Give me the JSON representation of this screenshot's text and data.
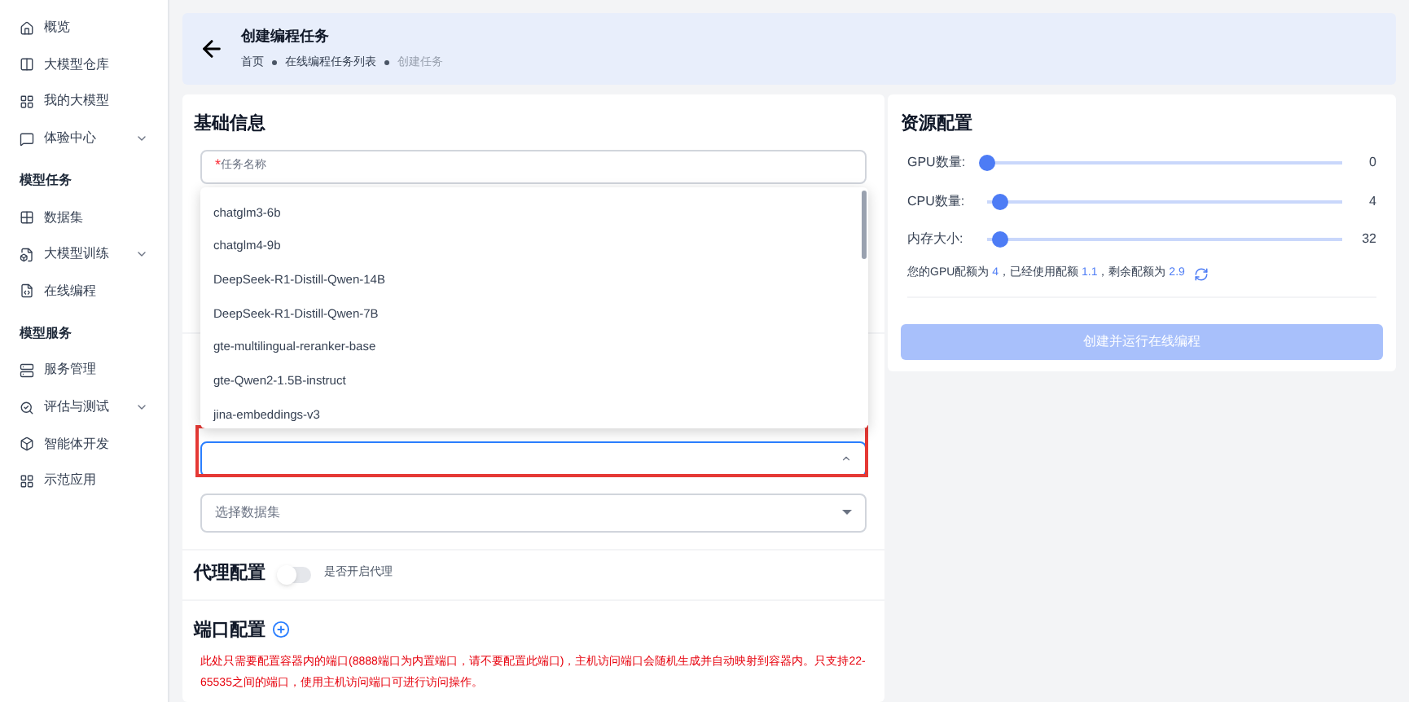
{
  "sidebar": {
    "groups": [
      {
        "items": [
          {
            "label": "概览",
            "expandable": false
          },
          {
            "label": "大模型仓库",
            "expandable": false
          },
          {
            "label": "我的大模型",
            "expandable": false
          },
          {
            "label": "体验中心",
            "expandable": true
          }
        ]
      },
      {
        "heading": "模型任务",
        "items": [
          {
            "label": "数据集",
            "expandable": false
          },
          {
            "label": "大模型训练",
            "expandable": true
          },
          {
            "label": "在线编程",
            "expandable": false
          }
        ]
      },
      {
        "heading": "模型服务",
        "items": [
          {
            "label": "服务管理",
            "expandable": false
          },
          {
            "label": "评估与测试",
            "expandable": true
          },
          {
            "label": "智能体开发",
            "expandable": false
          },
          {
            "label": "示范应用",
            "expandable": false
          }
        ]
      }
    ]
  },
  "header": {
    "title": "创建编程任务",
    "breadcrumb": [
      "首页",
      "在线编程任务列表",
      "创建任务"
    ]
  },
  "basic": {
    "title": "基础信息",
    "task_name": {
      "placeholder": "任务名称",
      "required_mark": "*"
    }
  },
  "model_select": {
    "highlighted": true,
    "open": true,
    "options": [
      "chatglm3-6b",
      "chatglm4-9b",
      "DeepSeek-R1-Distill-Qwen-14B",
      "DeepSeek-R1-Distill-Qwen-7B",
      "gte-multilingual-reranker-base",
      "gte-Qwen2-1.5B-instruct",
      "jina-embeddings-v3"
    ]
  },
  "dataset_select": {
    "placeholder": "选择数据集"
  },
  "proxy": {
    "title": "代理配置",
    "label": "是否开启代理",
    "on": false
  },
  "ports": {
    "title": "端口配置",
    "note": "此处只需要配置容器内的端口(8888端口为内置端口，请不要配置此端口)，主机访问端口会随机生成并自动映射到容器内。只支持22-65535之间的端口，使用主机访问端口可进行访问操作。"
  },
  "resources": {
    "title": "资源配置",
    "sliders": [
      {
        "label": "GPU数量:",
        "level": 0,
        "reading": "0"
      },
      {
        "label": "CPU数量:",
        "level": 0.035,
        "reading": "4"
      },
      {
        "label": "内存大小:",
        "level": 0.035,
        "reading": "32"
      }
    ],
    "quota": [
      {
        "kind": "text",
        "text": "您的GPU配额为 "
      },
      {
        "kind": "value",
        "text": "4"
      },
      {
        "kind": "text",
        "text": "，已经使用配额 "
      },
      {
        "kind": "value",
        "text": "1.1"
      },
      {
        "kind": "text",
        "text": "，剩余配额为 "
      },
      {
        "kind": "value",
        "text": "2.9"
      }
    ],
    "submit": {
      "label": "创建并运行在线编程",
      "disabled": true
    }
  }
}
